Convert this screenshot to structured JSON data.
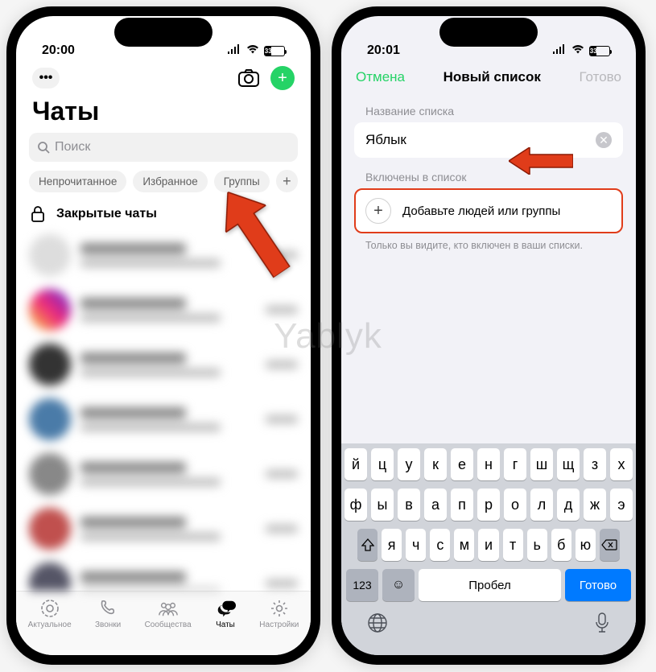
{
  "watermark": "Yablyk",
  "left": {
    "time": "20:00",
    "battery": "33",
    "title": "Чаты",
    "search_placeholder": "Поиск",
    "chips": [
      "Непрочитанное",
      "Избранное",
      "Группы"
    ],
    "locked_chats": "Закрытые чаты",
    "tabs": {
      "updates": "Актуальное",
      "calls": "Звонки",
      "communities": "Сообщества",
      "chats": "Чаты",
      "settings": "Настройки"
    }
  },
  "right": {
    "time": "20:01",
    "battery": "33",
    "cancel": "Отмена",
    "title": "Новый список",
    "done": "Готово",
    "name_label": "Название списка",
    "name_value": "Яблык",
    "include_label": "Включены в список",
    "add_people": "Добавьте людей или группы",
    "hint": "Только вы видите, кто включен в ваши списки.",
    "keyboard": {
      "row1": [
        "й",
        "ц",
        "у",
        "к",
        "е",
        "н",
        "г",
        "ш",
        "щ",
        "з",
        "х"
      ],
      "row2": [
        "ф",
        "ы",
        "в",
        "а",
        "п",
        "р",
        "о",
        "л",
        "д",
        "ж",
        "э"
      ],
      "row3": [
        "я",
        "ч",
        "с",
        "м",
        "и",
        "т",
        "ь",
        "б",
        "ю"
      ],
      "num": "123",
      "space": "Пробел",
      "submit": "Готово"
    }
  }
}
